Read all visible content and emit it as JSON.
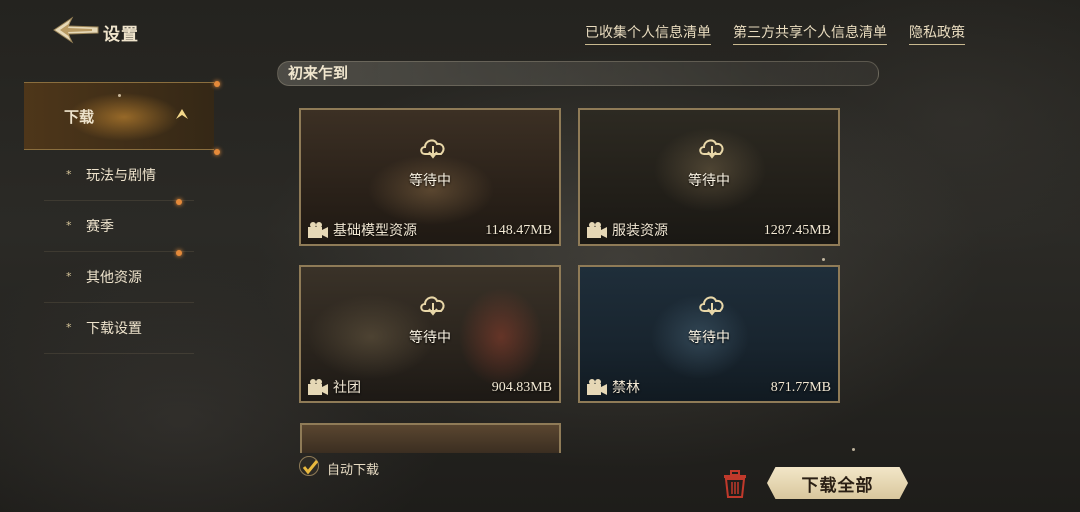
{
  "header": {
    "title": "设置",
    "links": [
      "已收集个人信息清单",
      "第三方共享个人信息清单",
      "隐私政策"
    ]
  },
  "sidebar": {
    "items": [
      {
        "label": "下载",
        "active": true
      },
      {
        "label": "玩法与剧情",
        "active": false
      },
      {
        "label": "赛季",
        "active": false
      },
      {
        "label": "其他资源",
        "active": false
      },
      {
        "label": "下载设置",
        "active": false
      }
    ]
  },
  "section": {
    "title": "初来乍到"
  },
  "cards": [
    {
      "name": "基础模型资源",
      "size": "1148.47MB",
      "status": "等待中"
    },
    {
      "name": "服装资源",
      "size": "1287.45MB",
      "status": "等待中"
    },
    {
      "name": "社团",
      "size": "904.83MB",
      "status": "等待中"
    },
    {
      "name": "禁林",
      "size": "871.77MB",
      "status": "等待中"
    }
  ],
  "footer": {
    "auto_download_label": "自动下载",
    "auto_download_checked": true,
    "download_all_label": "下载全部"
  },
  "colors": {
    "accent_gold": "#c9a45a",
    "sidebar_dot": "#e58a3a",
    "trash_red": "#c0392b"
  },
  "icons": [
    "back-arrow-icon",
    "collapse-arrow-icon",
    "download-cloud-icon",
    "camera-icon",
    "checkmark-icon",
    "trash-icon"
  ]
}
